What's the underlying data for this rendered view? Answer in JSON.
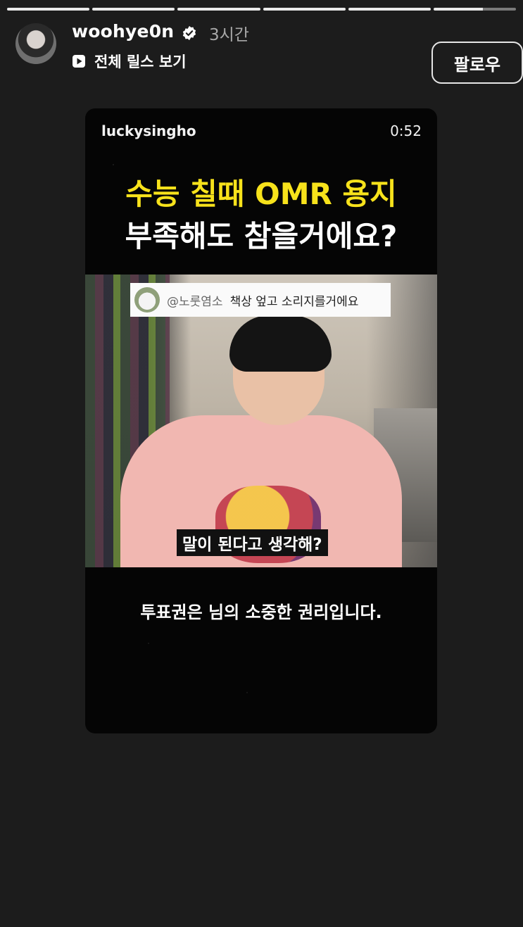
{
  "story": {
    "progress_segments": 6
  },
  "header": {
    "username": "woohye0n",
    "time": "3시간",
    "reels_link_label": "전체 릴스 보기",
    "follow_label": "팔로우"
  },
  "reel": {
    "author": "luckysingho",
    "duration": "0:52",
    "title_line1": "수능 칠때 OMR 용지",
    "title_line2": "부족해도 참을거에요?",
    "comment_user": "@노룻염소",
    "comment_text": "책상 엎고 소리지를거에요",
    "video_subtitle": "말이 된다고 생각해?",
    "caption": "투표권은 님의 소중한 권리입니다.",
    "title_highlight_color": "#f7e21b"
  }
}
